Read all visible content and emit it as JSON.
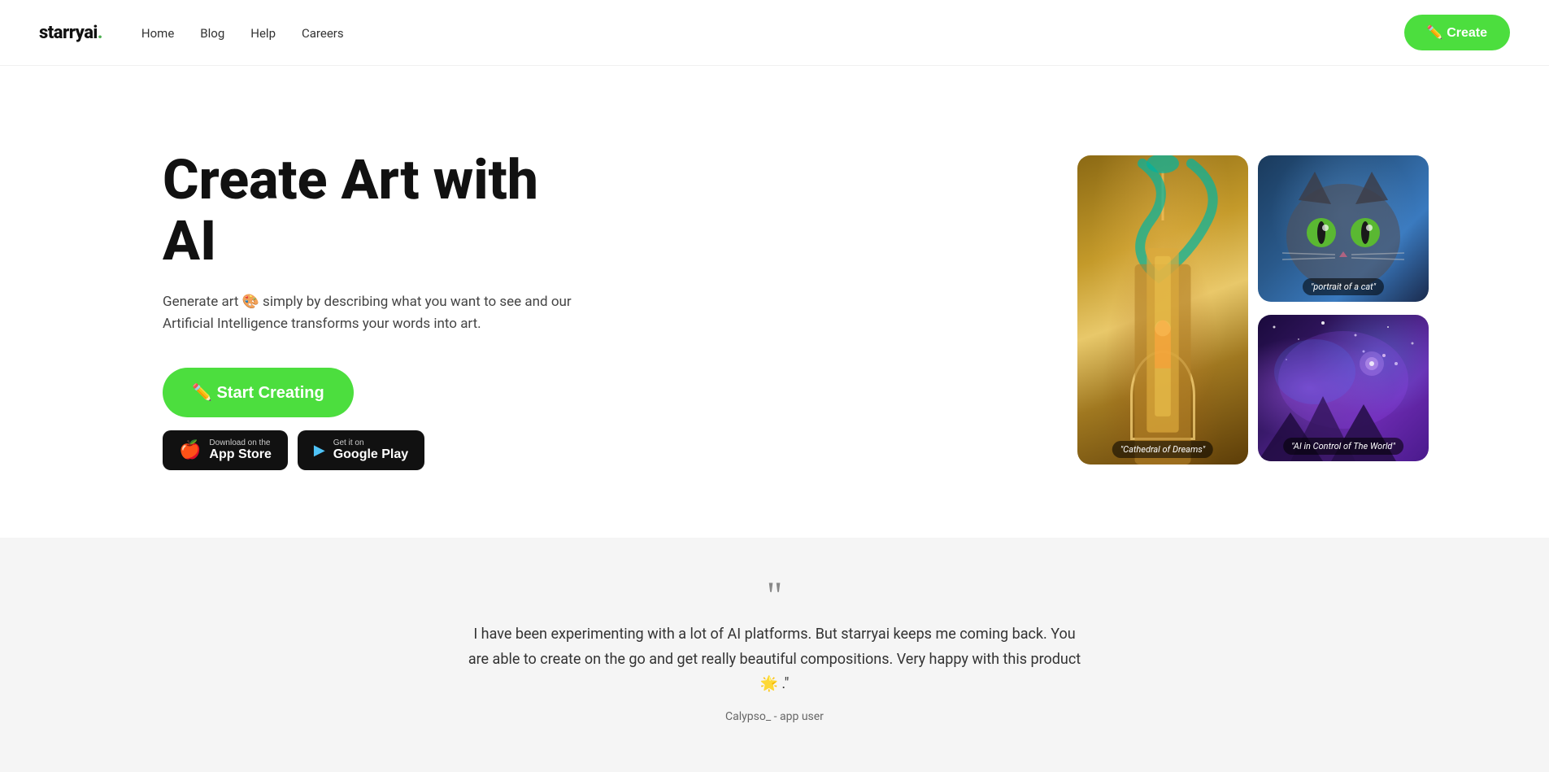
{
  "brand": {
    "name": "starryai",
    "dot": "."
  },
  "nav": {
    "links": [
      {
        "label": "Home",
        "href": "#"
      },
      {
        "label": "Blog",
        "href": "#"
      },
      {
        "label": "Help",
        "href": "#"
      },
      {
        "label": "Careers",
        "href": "#"
      }
    ],
    "create_button": "✏️ Create"
  },
  "hero": {
    "title": "Create Art with AI",
    "description_prefix": "Generate art 🎨 simply by describing what you want to see and our Artificial Intelligence transforms your words into art.",
    "start_button": "✏️ Start Creating",
    "app_store": {
      "prefix": "Download on the",
      "name": "App Store",
      "icon": "🍎"
    },
    "google_play": {
      "prefix": "Get it on",
      "name": "Google Play",
      "icon": "▶"
    }
  },
  "art_cards": [
    {
      "id": "cathedral",
      "label": "\"Cathedral of Dreams\"",
      "type": "tall"
    },
    {
      "id": "cat",
      "label": "\"portrait of a cat\"",
      "type": "short"
    },
    {
      "id": "space",
      "label": "\"AI in Control of The World\"",
      "type": "short"
    }
  ],
  "testimonial": {
    "quote_mark": "\"",
    "text": "I have been experimenting with a lot of AI platforms. But starryai keeps me coming back. You are able to create on the go and get really beautiful compositions. Very happy with this product 🌟 .\"",
    "author": "Calypso_ - app user"
  }
}
